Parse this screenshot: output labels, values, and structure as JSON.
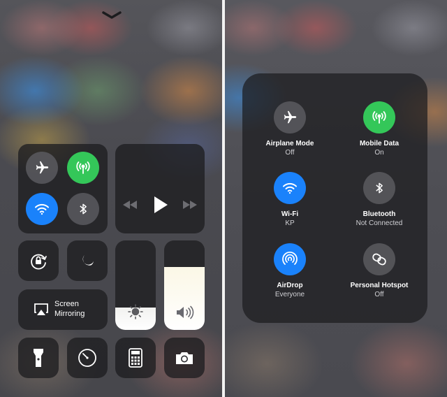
{
  "left_panel": {
    "connectivity": {
      "airplane": {
        "icon": "airplane-icon",
        "color": "#5a5a5f"
      },
      "cellular": {
        "icon": "antenna-icon",
        "color": "#34c759"
      },
      "wifi": {
        "icon": "wifi-icon",
        "color": "#1a82fb"
      },
      "bluetooth": {
        "icon": "bluetooth-icon",
        "color": "#5a5a5f"
      }
    },
    "media": {
      "rewind": "rewind-icon",
      "play": "play-icon",
      "forward": "fast-forward-icon"
    },
    "screen_mirroring": {
      "line1": "Screen",
      "line2": "Mirroring"
    },
    "brightness_level": 0.25,
    "volume_level": 0.7,
    "bottom_row": [
      "flashlight-icon",
      "timer-icon",
      "calculator-icon",
      "camera-icon"
    ]
  },
  "right_panel": {
    "items": [
      {
        "title": "Airplane Mode",
        "status": "Off",
        "icon": "airplane-icon",
        "color": "#5a5a5f"
      },
      {
        "title": "Mobile Data",
        "status": "On",
        "icon": "antenna-icon",
        "color": "#34c759"
      },
      {
        "title": "Wi-Fi",
        "status": "KP",
        "icon": "wifi-icon",
        "color": "#1a82fb"
      },
      {
        "title": "Bluetooth",
        "status": "Not Connected",
        "icon": "bluetooth-icon",
        "color": "#5a5a5f"
      },
      {
        "title": "AirDrop",
        "status": "Everyone",
        "icon": "airdrop-icon",
        "color": "#1a82fb"
      },
      {
        "title": "Personal Hotspot",
        "status": "Off",
        "icon": "hotspot-link-icon",
        "color": "#5a5a5f"
      }
    ]
  }
}
